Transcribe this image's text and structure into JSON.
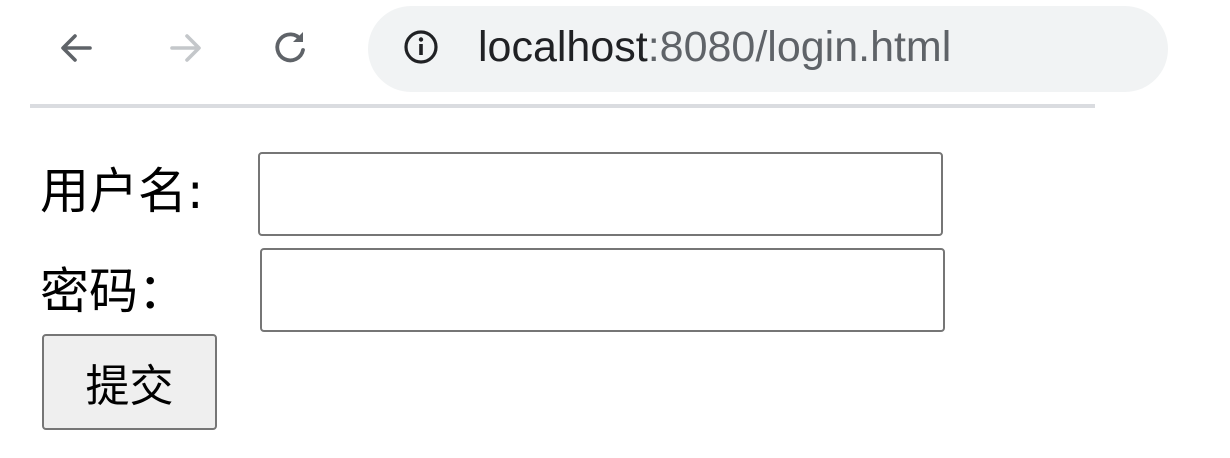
{
  "browser": {
    "back_icon": "arrow-left-icon",
    "forward_icon": "arrow-right-icon",
    "reload_icon": "reload-icon",
    "site_info_icon": "info-circle-icon",
    "url_host": "localhost",
    "url_rest": ":8080/login.html"
  },
  "form": {
    "username_label": "用户名:",
    "username_value": "",
    "password_label": "密码：",
    "password_value": "",
    "submit_label": "提交"
  }
}
